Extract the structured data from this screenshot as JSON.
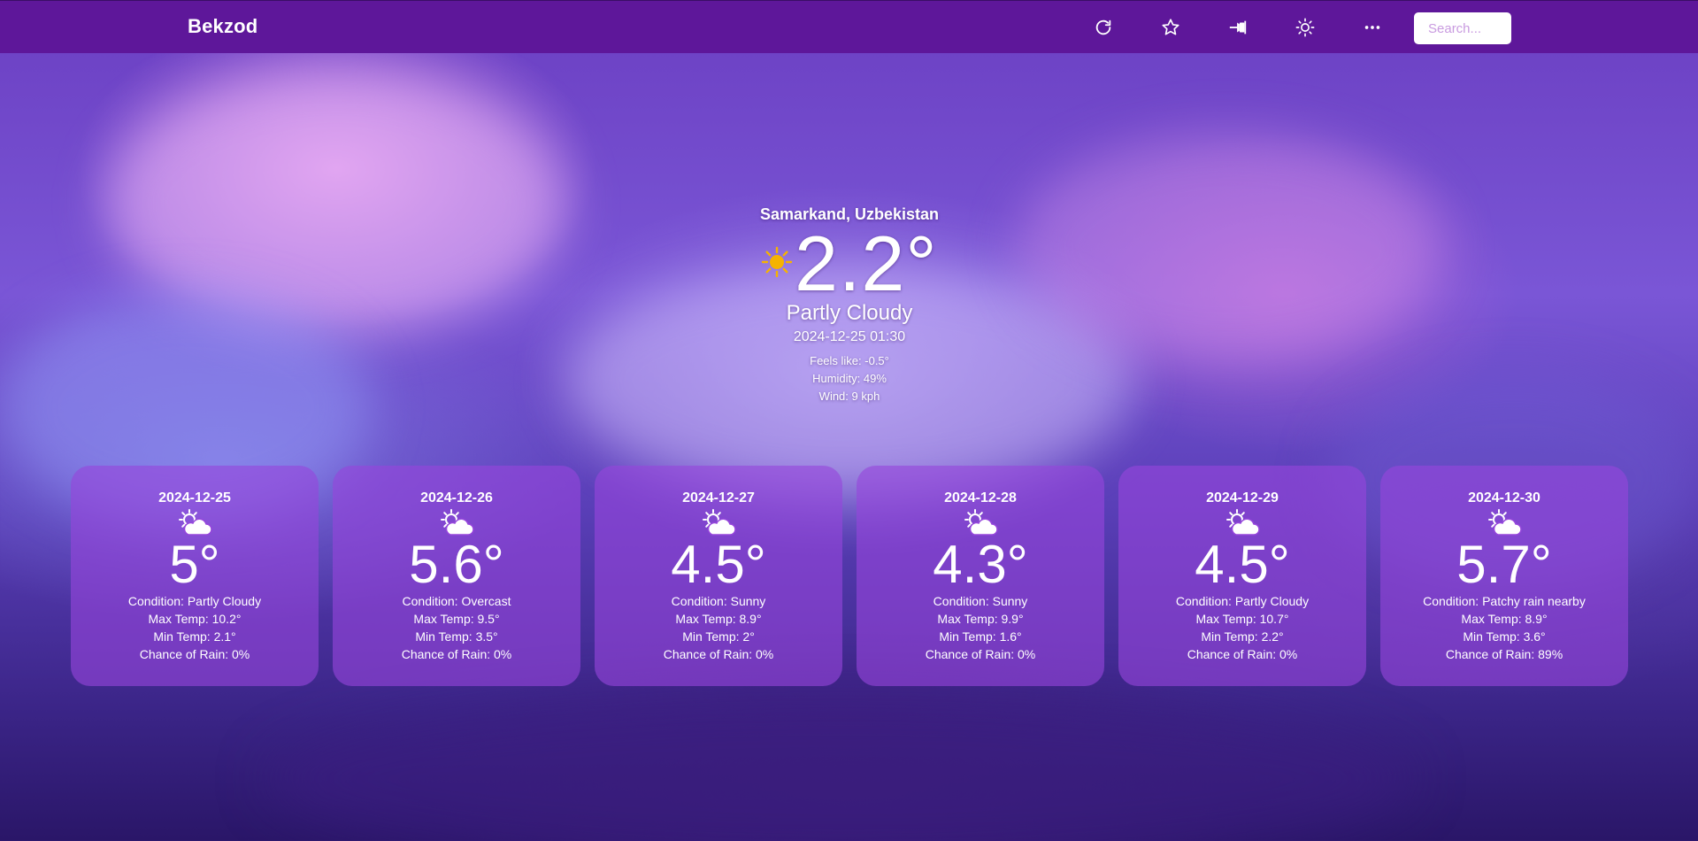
{
  "app": {
    "brand": "Bekzod",
    "search_placeholder": "Search..."
  },
  "toolbar": {
    "icons": [
      "refresh-icon",
      "star-icon",
      "pin-icon",
      "brightness-icon",
      "more-icon"
    ]
  },
  "current": {
    "location": "Samarkand, Uzbekistan",
    "icon": "sun-icon",
    "temperature": "2.2°",
    "condition": "Partly Cloudy",
    "datetime": "2024-12-25 01:30",
    "feels_like": "Feels like: -0.5°",
    "humidity": "Humidity: 49%",
    "wind": "Wind: 9 kph"
  },
  "forecast": [
    {
      "date": "2024-12-25",
      "icon": "partly-cloudy-icon",
      "temp": "5°",
      "condition": "Condition: Partly Cloudy",
      "max_temp": "Max Temp: 10.2°",
      "min_temp": "Min Temp: 2.1°",
      "rain": "Chance of Rain: 0%"
    },
    {
      "date": "2024-12-26",
      "icon": "partly-cloudy-icon",
      "temp": "5.6°",
      "condition": "Condition: Overcast",
      "max_temp": "Max Temp: 9.5°",
      "min_temp": "Min Temp: 3.5°",
      "rain": "Chance of Rain: 0%"
    },
    {
      "date": "2024-12-27",
      "icon": "partly-cloudy-icon",
      "temp": "4.5°",
      "condition": "Condition: Sunny",
      "max_temp": "Max Temp: 8.9°",
      "min_temp": "Min Temp: 2°",
      "rain": "Chance of Rain: 0%"
    },
    {
      "date": "2024-12-28",
      "icon": "partly-cloudy-icon",
      "temp": "4.3°",
      "condition": "Condition: Sunny",
      "max_temp": "Max Temp: 9.9°",
      "min_temp": "Min Temp: 1.6°",
      "rain": "Chance of Rain: 0%"
    },
    {
      "date": "2024-12-29",
      "icon": "partly-cloudy-icon",
      "temp": "4.5°",
      "condition": "Condition: Partly Cloudy",
      "max_temp": "Max Temp: 10.7°",
      "min_temp": "Min Temp: 2.2°",
      "rain": "Chance of Rain: 0%"
    },
    {
      "date": "2024-12-30",
      "icon": "partly-cloudy-icon",
      "temp": "5.7°",
      "condition": "Condition: Patchy rain nearby",
      "max_temp": "Max Temp: 8.9°",
      "min_temp": "Min Temp: 3.6°",
      "rain": "Chance of Rain: 89%"
    }
  ],
  "colors": {
    "topbar": "#5e179a",
    "card": "#9646dc",
    "sun": "#f5b301"
  }
}
